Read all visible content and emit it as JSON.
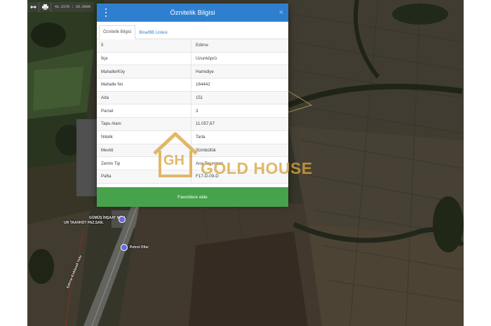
{
  "toolbar": {
    "coords": "41.1578 : 26.6690",
    "icons": [
      "move-horizontal-icon",
      "print-icon"
    ]
  },
  "modal": {
    "title": "Öznitelik Bilgisi",
    "close": "×",
    "tabs": [
      "Öznitelik Bilgisi",
      "Bina/BB Listesi"
    ],
    "rows": [
      {
        "key": "İl",
        "value": "Edirne"
      },
      {
        "key": "İlçe",
        "value": "Uzunköprü"
      },
      {
        "key": "Mahalle/Köy",
        "value": "Hamidiye"
      },
      {
        "key": "Mahalle No",
        "value": "164442"
      },
      {
        "key": "Ada",
        "value": "151"
      },
      {
        "key": "Parsel",
        "value": "3"
      },
      {
        "key": "Tapu Alanı",
        "value": "11.057,67"
      },
      {
        "key": "Nitelik",
        "value": "Tarla"
      },
      {
        "key": "Mevkii",
        "value": "Sümbüllük"
      },
      {
        "key": "Zemin Tip",
        "value": "Ana Taşınmaz"
      },
      {
        "key": "Pafta",
        "value": "F17-D-09-D"
      }
    ],
    "favorite_button": "Favorilere ekle"
  },
  "watermark": {
    "logo_letters": "GH",
    "text": "GOLD HOUSE",
    "color": "#d8a640"
  },
  "map_labels": {
    "company": "GÜMÜŞ İNŞAAT MÜH.",
    "company2": "UR TAAHHÜT PAZ.SAN.",
    "gas_station": "Petrol Ofisi",
    "road": "Edirne-Kırklareli Yolu"
  },
  "colors": {
    "header": "#2f7fd0",
    "button": "#47a24c",
    "tab_link": "#2f7fd0"
  }
}
